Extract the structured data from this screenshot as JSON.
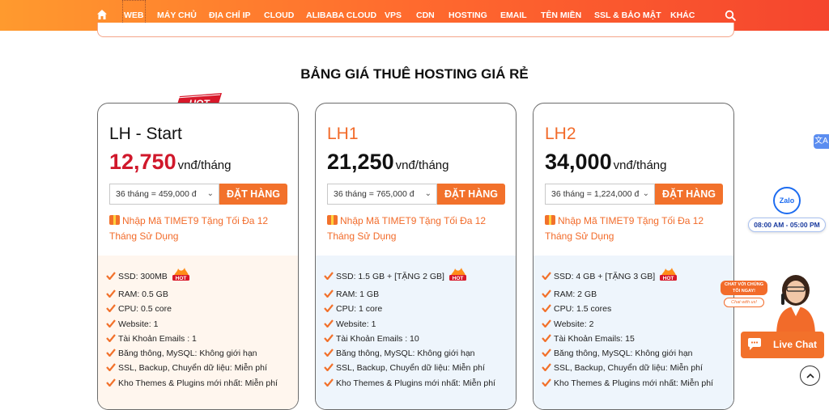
{
  "nav": {
    "items": [
      "WEB",
      "MÁY CHỦ",
      "ĐỊA CHỈ IP",
      "CLOUD",
      "ALIBABA CLOUD",
      "VPS",
      "CDN",
      "HOSTING",
      "EMAIL",
      "TÊN MIỀN",
      "SSL & BẢO MẬT",
      "KHÁC"
    ],
    "active": "WEB",
    "home_icon": "home-icon",
    "search_icon": "search-icon"
  },
  "section": {
    "title": "BẢNG GIÁ THUÊ HOSTING GIÁ RẺ"
  },
  "badge_hot": "HOT",
  "plans": [
    {
      "name": "LH - Start",
      "price": "12,750",
      "unit": "vnđ/tháng",
      "select_value": "36 tháng = 459,000 đ",
      "order_label": "ĐẶT HÀNG",
      "promo": "Nhập Mã TIMET9 Tặng Tối Đa 12 Tháng Sử Dụng",
      "features": [
        "SSD: 300MB",
        "RAM: 0.5 GB",
        "CPU: 0.5 core",
        "Website: 1",
        "Tài Khoản Emails : 1",
        "Băng thông, MySQL: Không giới hạn",
        "SSL, Backup, Chuyển dữ liệu: Miễn phí",
        "Kho Themes & Plugins mới nhất: Miễn phí"
      ]
    },
    {
      "name": "LH1",
      "price": "21,250",
      "unit": "vnđ/tháng",
      "select_value": "36 tháng = 765,000 đ",
      "order_label": "ĐẶT HÀNG",
      "promo": "Nhập Mã TIMET9 Tặng Tối Đa 12 Tháng Sử Dụng",
      "features": [
        "SSD: 1.5 GB + [TẶNG 2 GB]",
        "RAM: 1 GB",
        "CPU: 1 core",
        "Website: 1",
        "Tài Khoản Emails : 10",
        "Băng thông, MySQL: Không giới hạn",
        "SSL, Backup, Chuyển dữ liệu: Miễn phí",
        "Kho Themes & Plugins mới nhất: Miễn phí"
      ]
    },
    {
      "name": "LH2",
      "price": "34,000",
      "unit": "vnđ/tháng",
      "select_value": "36 tháng = 1,224,000 đ",
      "order_label": "ĐẶT HÀNG",
      "promo": "Nhập Mã TIMET9 Tặng Tối Đa 12 Tháng Sử Dụng",
      "features": [
        "SSD: 4 GB + [TẶNG 3 GB]",
        "RAM: 2 GB",
        "CPU: 1.5 cores",
        "Website: 2",
        "Tài Khoản Emails: 15",
        "Băng thông, MySQL: Không giới hạn",
        "SSL, Backup, Chuyển dữ liệu: Miễn phí",
        "Kho Themes & Plugins mới nhất: Miễn phí"
      ]
    }
  ],
  "widgets": {
    "zalo_label": "Zalo",
    "hours": "08:00 AM - 05:00 PM",
    "chat_bubble_top": "CHAT VỚI CHÚNG TÔI NGAY!",
    "chat_bubble_bottom": "Chat with us!",
    "live_chat": "Live Chat",
    "translate_label": "文A"
  },
  "colors": {
    "accent": "#f2712b",
    "price_red": "#d0182b",
    "nav_start": "#ff9a2e",
    "nav_end": "#f5452e"
  }
}
